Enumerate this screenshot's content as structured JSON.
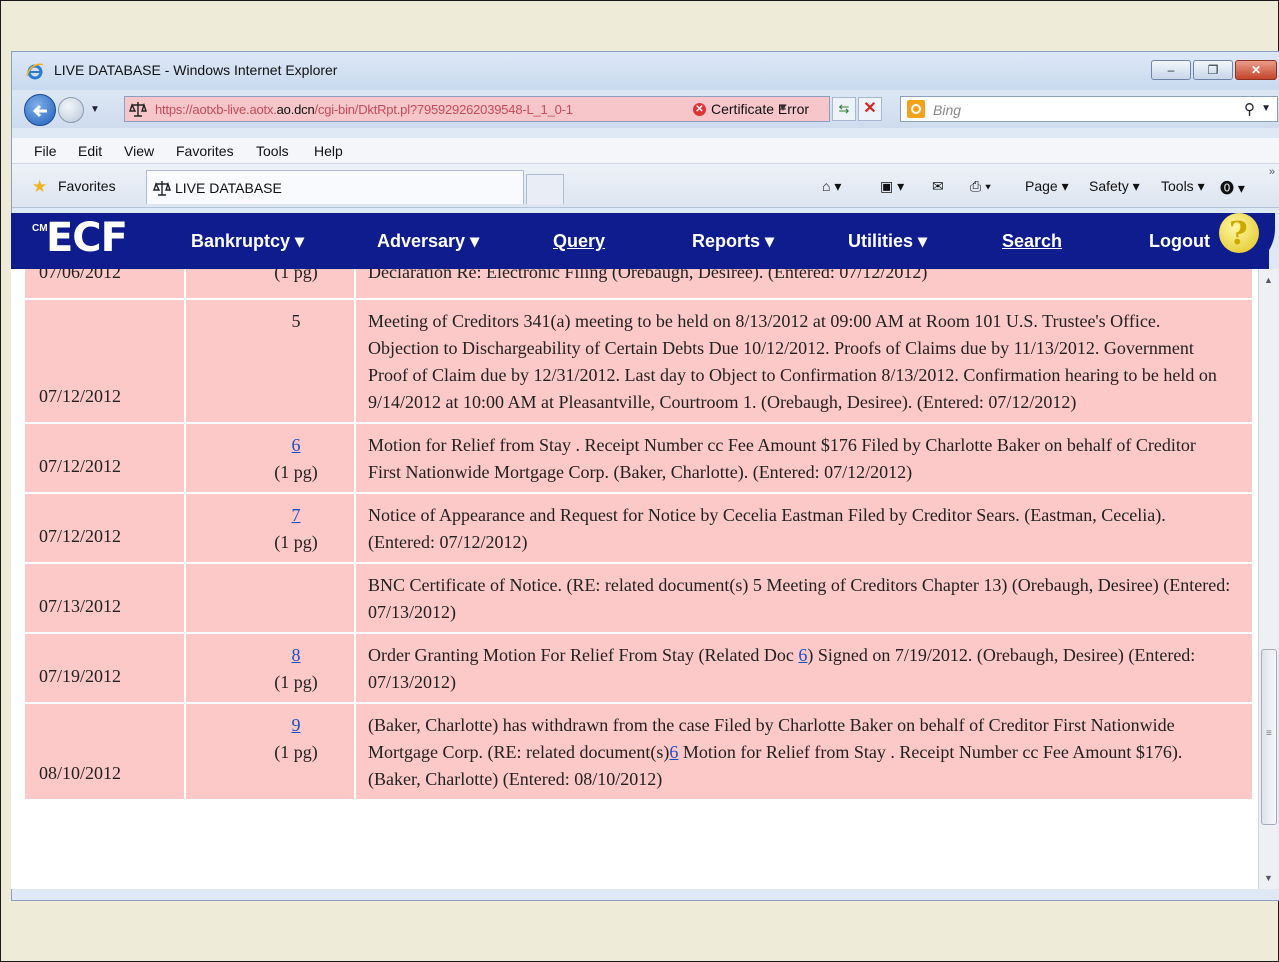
{
  "window": {
    "title": "LIVE DATABASE - Windows Internet Explorer",
    "controls": {
      "minimize": "–",
      "restore": "❐",
      "close": "✕"
    }
  },
  "address": {
    "url_prefix": "https://aotxb-live.aotx.",
    "url_host": "ao.dcn",
    "url_path": "/cgi-bin/DktRpt.pl?795929262039548-L_1_0-1",
    "cert_error": "Certificate Error",
    "search_placeholder": "Bing"
  },
  "menu": [
    "File",
    "Edit",
    "View",
    "Favorites",
    "Tools",
    "Help"
  ],
  "favorites": {
    "label": "Favorites",
    "tab_title": "LIVE DATABASE",
    "commands": {
      "page": "Page",
      "safety": "Safety",
      "tools": "Tools"
    }
  },
  "ecf": {
    "logo": "ECF",
    "logo_prefix": "CM",
    "nav": {
      "bankruptcy": "Bankruptcy",
      "adversary": "Adversary",
      "query": "Query",
      "reports": "Reports",
      "utilities": "Utilities",
      "search": "Search",
      "logout": "Logout"
    },
    "help": "?"
  },
  "docket": {
    "partial_top": {
      "date": "07/06/2012",
      "pages": "(1 pg)",
      "text": "Declaration Re: Electronic Filing (Orebaugh, Desiree). (Entered: 07/12/2012)"
    },
    "rows": [
      {
        "date": "07/12/2012",
        "number": "5",
        "pages": "",
        "text": "Meeting of Creditors 341(a) meeting to be held on 8/13/2012 at 09:00 AM at Room 101 U.S. Trustee's Office. Objection to Dischargeability of Certain Debts Due 10/12/2012. Proofs of Claims due by 11/13/2012. Government Proof of Claim due by 12/31/2012. Last day to Object to Confirmation 8/13/2012. Confirmation hearing to be held on 9/14/2012 at 10:00 AM at Pleasantville, Courtroom 1. (Orebaugh, Desiree). (Entered: 07/12/2012)"
      },
      {
        "date": "07/12/2012",
        "number": "6",
        "pages": "(1 pg)",
        "text": "Motion for Relief from Stay . Receipt Number cc Fee Amount $176 Filed by Charlotte Baker on behalf of Creditor First Nationwide Mortgage Corp. (Baker, Charlotte). (Entered: 07/12/2012)"
      },
      {
        "date": "07/12/2012",
        "number": "7",
        "pages": "(1 pg)",
        "text": "Notice of Appearance and Request for Notice by Cecelia Eastman Filed by Creditor Sears. (Eastman, Cecelia). (Entered: 07/12/2012)"
      },
      {
        "date": "07/13/2012",
        "number": "",
        "pages": "",
        "text": "BNC Certificate of Notice. (RE: related document(s) 5 Meeting of Creditors Chapter 13) (Orebaugh, Desiree) (Entered: 07/13/2012)"
      },
      {
        "date": "07/19/2012",
        "number": "8",
        "pages": "(1 pg)",
        "text_before": "Order Granting Motion For Relief From Stay (Related Doc ",
        "link": "6",
        "text_after": ") Signed on 7/19/2012. (Orebaugh, Desiree) (Entered: 07/13/2012)"
      },
      {
        "date": "08/10/2012",
        "number": "9",
        "pages": "(1 pg)",
        "text_before": "(Baker, Charlotte) has withdrawn from the case Filed by Charlotte Baker on behalf of Creditor First Nationwide Mortgage Corp. (RE: related document(s)",
        "link": "6",
        "text_after": " Motion for Relief from Stay . Receipt Number cc Fee Amount $176). (Baker, Charlotte) (Entered: 08/10/2012)"
      }
    ]
  }
}
